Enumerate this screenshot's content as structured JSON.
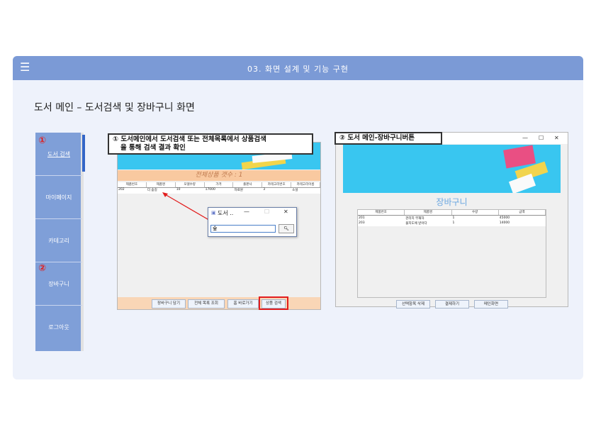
{
  "header": {
    "menu_icon": "hamburger-icon",
    "title": "03. 화면 설계 및 기능 구현"
  },
  "page": {
    "title": "도서 메인 – 도서검색 및 장바구니 화면"
  },
  "sidebar": {
    "items": [
      {
        "label": "도서 검색"
      },
      {
        "label": "마이페이지"
      },
      {
        "label": "카테고리"
      },
      {
        "label": "장바구니"
      },
      {
        "label": "로그아웃"
      }
    ]
  },
  "markers": {
    "one": "①",
    "two": "②"
  },
  "search_screen": {
    "caption_line1": "① 도서메인에서 도서검색 또는 전체목록에서 상품검색",
    "caption_line2": "을 통해 검색 결과 확인",
    "count_text": "전체상품 갯수 : 1",
    "columns": [
      "제품번호",
      "제품명",
      "모델수량",
      "가격",
      "출판사",
      "카테고리번호",
      "카테고리이름"
    ],
    "rows": [
      [
        "202",
        "더 숲길",
        "10",
        "17000",
        "자료원",
        "3",
        "소설"
      ]
    ],
    "buttons": [
      "장바구니 담기",
      "전체 목록 조회",
      "홈 바로가기",
      "상품 검색"
    ],
    "dialog": {
      "title": "도서 ..",
      "minimize": "—",
      "maximize": "☐",
      "close": "✕",
      "input_value": "숲",
      "search_icon": "search-icon"
    }
  },
  "cart_screen": {
    "caption": "② 도서 메인-장바구니버튼",
    "win_minimize": "—",
    "win_maximize": "☐",
    "win_close": "✕",
    "title": "장바구니",
    "columns": [
      "제품번호",
      "제품명",
      "수량",
      "금액"
    ],
    "rows": [
      [
        "201",
        "관리지 부재하",
        "1",
        "45000"
      ],
      [
        "203",
        "물지도에 받아다",
        "1",
        "14000"
      ]
    ],
    "buttons": [
      "선택항목 삭제",
      "결제하기",
      "메인화면"
    ]
  },
  "colors": {
    "accent": "#7b9ad6",
    "highlight": "#e21d1d",
    "banner": "#39c6f0"
  }
}
